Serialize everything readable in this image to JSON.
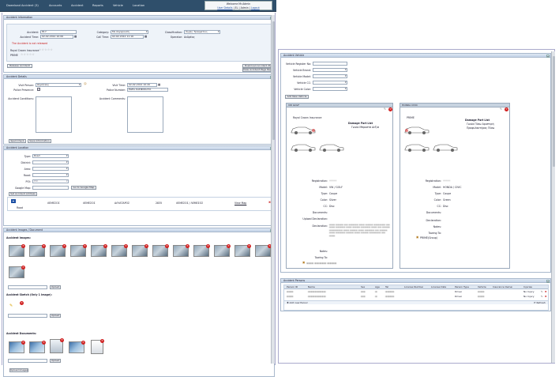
{
  "nav": {
    "items": [
      "Download Accident (3)",
      "Accounts",
      "Accident",
      "Reports",
      "Vehicle",
      "Location"
    ],
    "welcome": "Welcome Mr.Admin",
    "user_details": "User Details",
    "lang": "EL",
    "admin": "Admin",
    "logout": "Logout"
  },
  "info": {
    "title": "Accident Information",
    "accident_label": "Accident:",
    "accident_value": "817",
    "category_label": "Category:",
    "category_value": "Με σύγκρουση",
    "classification_label": "Classification:",
    "classification_value": "Χωρίς Τραυματίες",
    "time_label": "Accident Time:",
    "time_value": "02-02-2012 10:06",
    "calltime_label": "Call Time:",
    "calltime_value": "02-02-2012 11:16",
    "operator_label": "Operator:",
    "operator_value": "Ανδρέας",
    "not_released": "The Accident is not released",
    "rating1": "Royal Crown Insurance",
    "rating2": "PRIME",
    "stars": "☆☆☆☆☆",
    "release_btn": "Release Accident",
    "download_zip": "Download Accident Zip",
    "view_report": "View Accident Page Report"
  },
  "details": {
    "title": "Accident Details",
    "visit_person_label": "Visit Person:",
    "visit_person_value": "Δημήτρης",
    "visit_time_label": "Visit Time:",
    "visit_time_value": "02-02-2012 10:20",
    "police_presence_label": "Police Presence:",
    "police_number_label": "Police Number:",
    "police_number_value": "ΕΔΕΑ ΚΑΣΙΦΟΚΑΤΑ",
    "conditions_label": "Accident Conditions:",
    "comments_label": "Accident Comments:",
    "spell_check": "Spell Check",
    "save_info": "Save Information"
  },
  "location": {
    "title": "Accident Location",
    "type_label": "Type:",
    "type_value": "Road",
    "district_label": "District:",
    "area_label": "Area:",
    "road_label": "Road:",
    "poi_label": "POI:",
    "poi_value": "POI",
    "google_map_label": "Google Map:",
    "goto_google": "Go to Google Map",
    "set_address": "Set Accident Address",
    "row": [
      "Road",
      "ΛΕΜΕΣΟΣ",
      "ΛΕΜΕΣΟΣ",
      "ΑΛΥΑΤΑΡΟΣ",
      "2835",
      "ΛΕΜΕΣΟΣ / ΛΕΜΕΣΟΣ",
      "View Map"
    ]
  },
  "images": {
    "title": "Accident Images / Document",
    "images_heading": "Accident Images:",
    "sketch_heading": "Accident Sketch (Only 1 Image):",
    "docs_heading": "Accident Documents:",
    "upload_btn": "Upload",
    "upload_images": "Upload Images"
  },
  "vehicle": {
    "title": "Accident Vehicle",
    "reg_label": "Vehicle Register No:",
    "brand_label": "Vehicle Brand:",
    "model_label": "Vehicle Model:",
    "cc_label": "Vehicle CC:",
    "color_label": "Vehicle Color:",
    "add_new": "Add New Vehicle",
    "card1_title": "VW GOLF",
    "card1_insurer": "Royal Crown Insurance",
    "card2_title": "HONDA CIVIC",
    "card2_insurer": "PRIME",
    "damage_heading": "Damage Part List",
    "card1_damage": "Γωνία Μπροστά Δεξιά",
    "card2_damage1": "Γωνία Πίσω Αριστερή",
    "card2_damage2": "Προφυλακτήρας Πίσω",
    "registration_label": "Registration:",
    "model_label2": "Model:",
    "type_label": "Type:",
    "color_label2": "Color:",
    "cc_label2": "CC:",
    "documents_label": "Documents:",
    "upload_decl_label": "Upload Declaration:",
    "declaration_label": "Declaration:",
    "notes_label": "Notes:",
    "towing_label": "Towing To:",
    "card1_model": "VW / GOLF",
    "card1_type": "Coupe",
    "card1_color": "Silver",
    "card1_cc": "Disc",
    "card2_model": "HONDA / CIVIC",
    "card2_type": "Coupe",
    "card2_color": "Green",
    "card2_cc": "Disc",
    "card2_towing": "PRIME(Group)"
  },
  "persons": {
    "title": "Accident Persons",
    "columns": [
      "Person ID",
      "Name",
      "Sex",
      "Age",
      "Tel",
      "License Number",
      "License Date",
      "Person Type",
      "Vehicle",
      "Insurance Owner",
      "Injuries"
    ],
    "rows": [
      {
        "type": "Driver",
        "injury": "No Injury"
      },
      {
        "type": "Driver",
        "injury": "No Injury"
      }
    ],
    "add_btn": "Add new Person",
    "refresh": "Refresh"
  },
  "colors": {
    "header": "#2f4f6b",
    "panel_head": "#c2d2e6",
    "danger": "#d01f1f"
  }
}
